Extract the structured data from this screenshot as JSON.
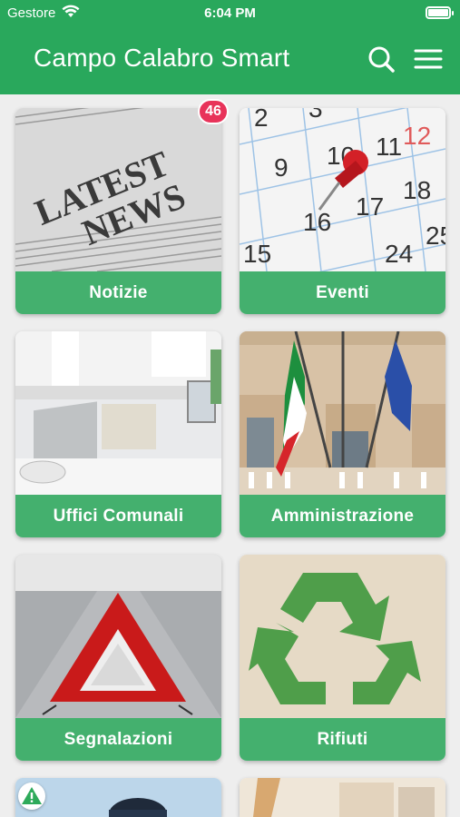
{
  "status_bar": {
    "carrier": "Gestore",
    "time": "6:04 PM"
  },
  "header": {
    "title": "Campo Calabro Smart",
    "search_icon": "search-icon",
    "menu_icon": "menu-icon"
  },
  "colors": {
    "primary": "#29a85c",
    "label_bg": "#44b06e",
    "badge": "#e8335a",
    "background": "#eeeeee"
  },
  "tiles": [
    {
      "label": "Notizie",
      "image": "newspaper-image",
      "badge": "46"
    },
    {
      "label": "Eventi",
      "image": "calendar-image"
    },
    {
      "label": "Uffici Comunali",
      "image": "office-image"
    },
    {
      "label": "Amministrazione",
      "image": "flags-building-image"
    },
    {
      "label": "Segnalazioni",
      "image": "warning-triangle-image"
    },
    {
      "label": "Rifiuti",
      "image": "recycle-image"
    },
    {
      "label": "",
      "image": "person-image",
      "icon": "alert-icon"
    },
    {
      "label": "",
      "image": "street-image"
    }
  ]
}
